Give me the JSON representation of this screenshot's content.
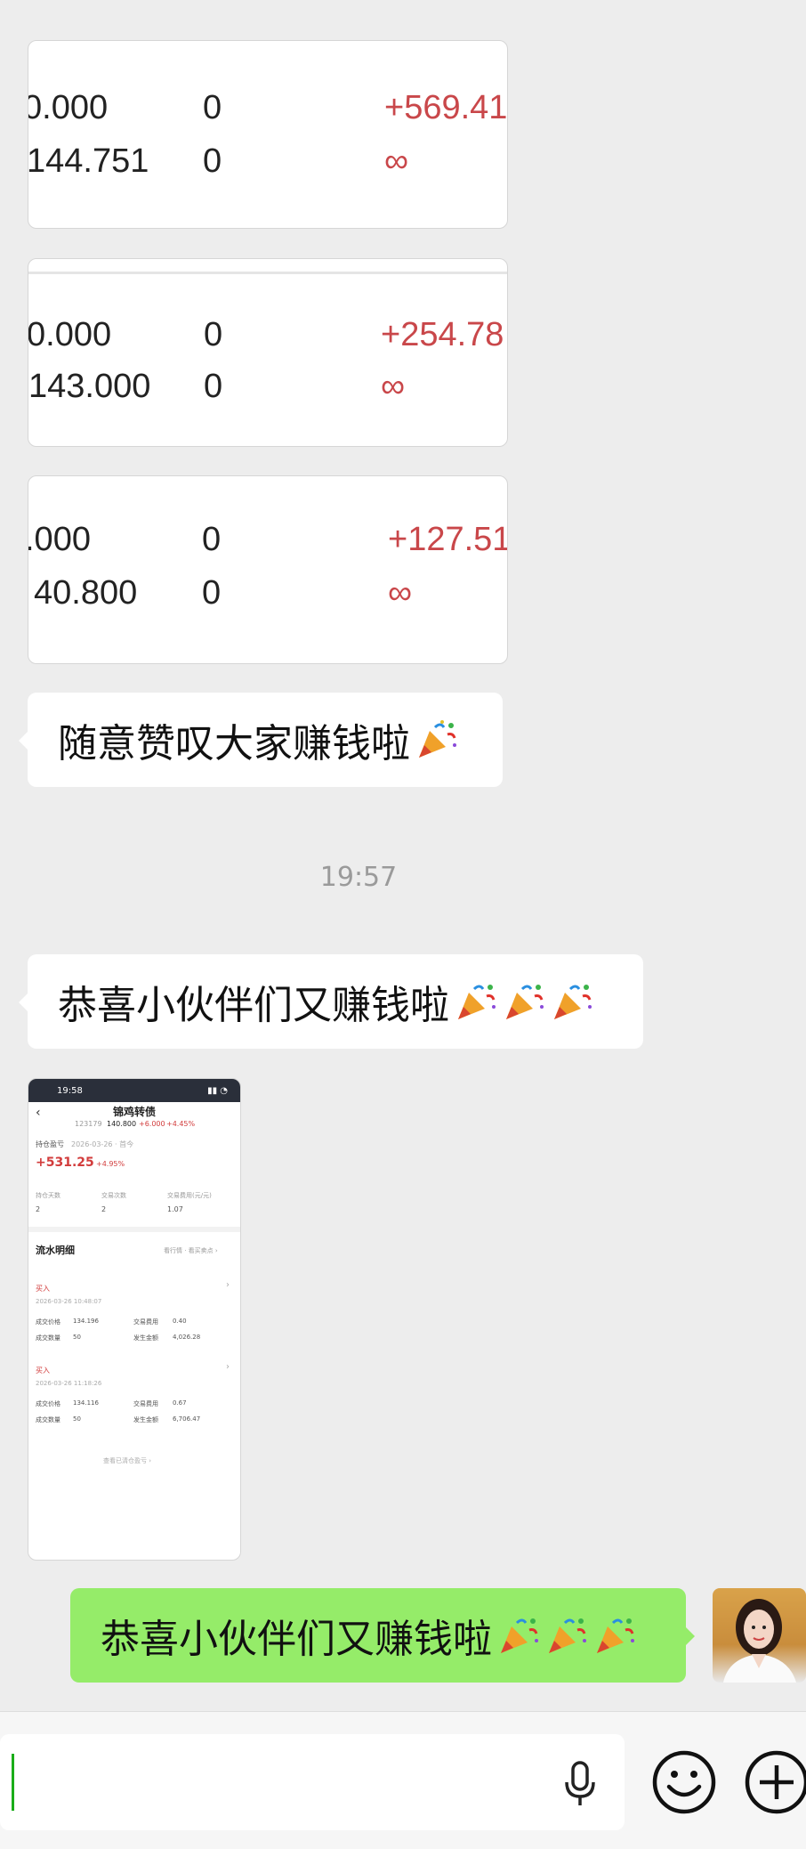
{
  "cards": [
    {
      "rows": [
        [
          "0.000",
          "0",
          "+569.41"
        ],
        [
          "144.751",
          "0",
          "∞"
        ]
      ]
    },
    {
      "rows": [
        [
          "0.000",
          "0",
          "+254.78"
        ],
        [
          "143.000",
          "0",
          "∞"
        ]
      ]
    },
    {
      "rows": [
        ".000",
        "0",
        "+127.51"
      ],
      "rows2": [
        "40.800",
        "0",
        "∞"
      ]
    }
  ],
  "messages": {
    "msg1": "随意赞叹大家赚钱啦",
    "timestamp": "19:57",
    "msg2": "恭喜小伙伴们又赚钱啦",
    "msg_me": "恭喜小伙伴们又赚钱啦"
  },
  "thumb": {
    "status_time": "19:58",
    "title": "锦鸡转债",
    "code": "123179",
    "price": "140.800",
    "change": "+6.000",
    "change_pct": "+4.45%",
    "holding_label": "持仓盈亏",
    "holding_date": "2026-03-26 · 首今",
    "profit": "+531.25",
    "profit_pct": "+4.95%",
    "stat_labels": [
      "持仓天数",
      "交易次数",
      "交易费用(元/元)"
    ],
    "stat_values": [
      "2",
      "2",
      "1.07"
    ],
    "flow_title": "流水明细",
    "flow_link": "看行情 · 看买卖点 ›",
    "trades": [
      {
        "side": "买入",
        "time": "2026-03-26  10:48:07",
        "price_label": "成交价格",
        "price": "134.196",
        "fee_label": "交易费用",
        "fee": "0.40",
        "qty_label": "成交数量",
        "qty": "50",
        "amount_label": "发生金额",
        "amount": "4,026.28"
      },
      {
        "side": "买入",
        "time": "2026-03-26  11:18:26",
        "price_label": "成交价格",
        "price": "134.116",
        "fee_label": "交易费用",
        "fee": "0.67",
        "qty_label": "成交数量",
        "qty": "50",
        "amount_label": "发生金额",
        "amount": "6,706.47"
      }
    ],
    "footer": "查看已清仓盈亏 ›"
  },
  "colors": {
    "chat_bg": "#ededed",
    "me_bubble": "#95ec69",
    "profit_red": "#c9474a",
    "cursor_green": "#1aad19"
  },
  "icons": {
    "voice": "microphone-icon",
    "emoji": "smiley-icon",
    "more": "plus-circle-icon",
    "party": "party-popper-icon"
  }
}
